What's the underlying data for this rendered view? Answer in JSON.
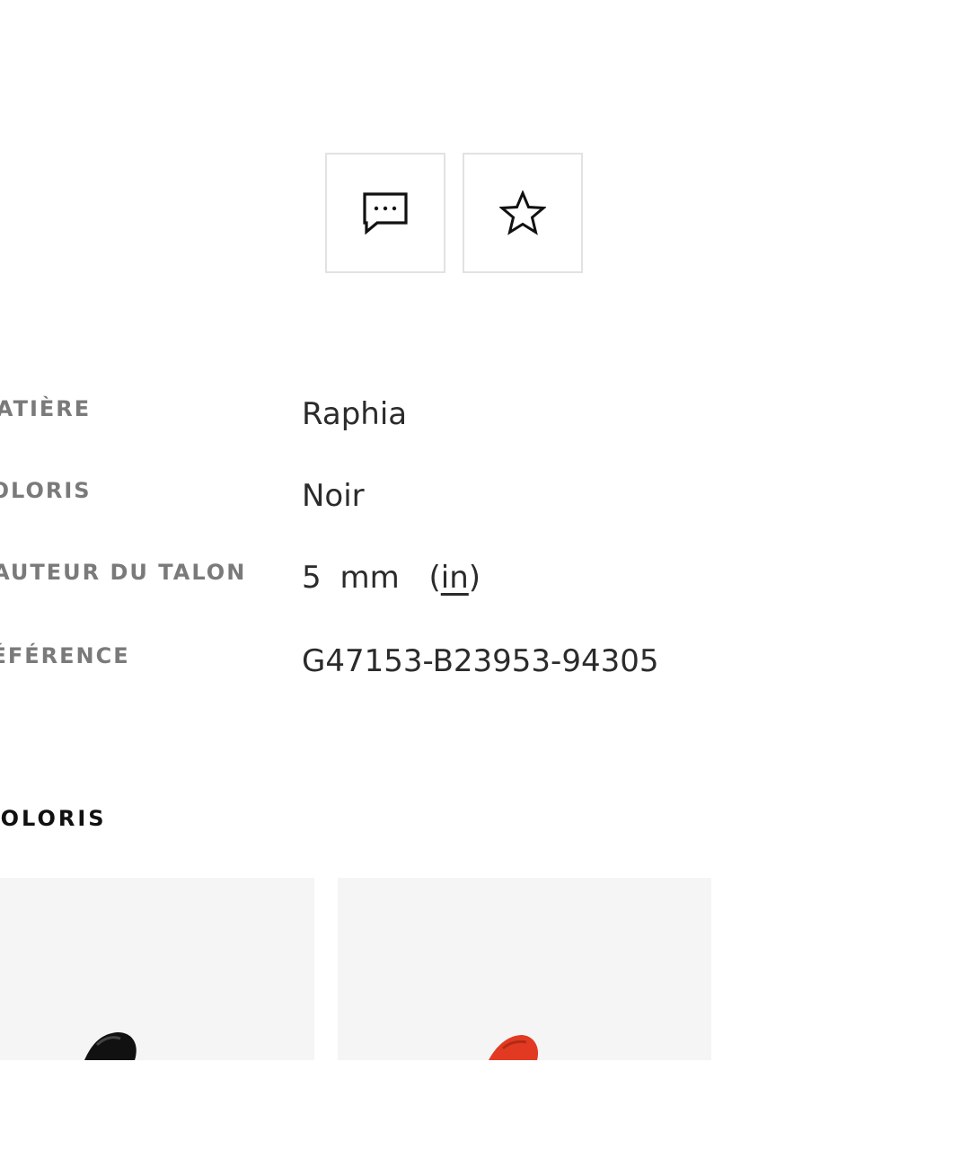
{
  "actions": {
    "message_icon": "chat-bubble-ellipsis-icon",
    "favorite_icon": "star-outline-icon"
  },
  "specs": [
    {
      "label": "MATIÈRE",
      "value": "Raphia"
    },
    {
      "label": "COLORIS",
      "value": "Noir"
    },
    {
      "label": "HAUTEUR DU TALON",
      "value": "5",
      "unit": "mm",
      "alt_unit": "in"
    },
    {
      "label": "RÉFÉRENCE",
      "value": "G47153-B23953-94305"
    }
  ],
  "colors_section": {
    "title": "COLORIS",
    "swatches": [
      {
        "name": "shoe-black",
        "color": "#111111"
      },
      {
        "name": "shoe-red",
        "color": "#e23a22"
      }
    ]
  }
}
